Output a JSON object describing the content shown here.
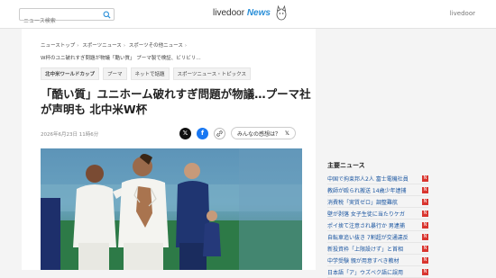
{
  "header": {
    "search_placeholder": "ニュース検索",
    "logo_main": "livedoor",
    "logo_news": "News",
    "brand_right": "livedoor"
  },
  "article": {
    "breadcrumbs": [
      "ニューストップ",
      "スポーツニュース",
      "スポーツその他ニュース"
    ],
    "breadcrumb_current": "W杯のユニ破れすぎ問題が物議「酷い質」 プーマ製で検証、ビリビリ…",
    "tags": [
      "北中米ワールドカップ",
      "プーマ",
      "ネットで話題",
      "スポーツニュース・トピックス"
    ],
    "headline": "「酷い質」ユニホーム破れすぎ問題が物議…プーマ社が声明も 北中米W杯",
    "date": "2026年6月23日 11時6分",
    "feel_label": "みんなの感想は？"
  },
  "sidebar": {
    "title": "主要ニュース",
    "items": [
      "中国で拘束邦人2人 富士電機社員",
      "教師が殴られ搬送 14歳少年逮捕",
      "消費税「実質ゼロ」調整難航",
      "壁が剥落 女子生徒に当たりケガ",
      "ポイ捨て注意され暴行か 男逮捕",
      "自転車追い抜き 7割超が交通違反",
      "新投資枠「上限設けず」と首相",
      "中学受験 親が用意すべき教材",
      "日本語「ア」ウズベク語に誤用"
    ],
    "badge": "N"
  },
  "colors": {
    "accent": "#2a8fd8",
    "badge": "#d9352f",
    "link": "#1a55a0"
  }
}
